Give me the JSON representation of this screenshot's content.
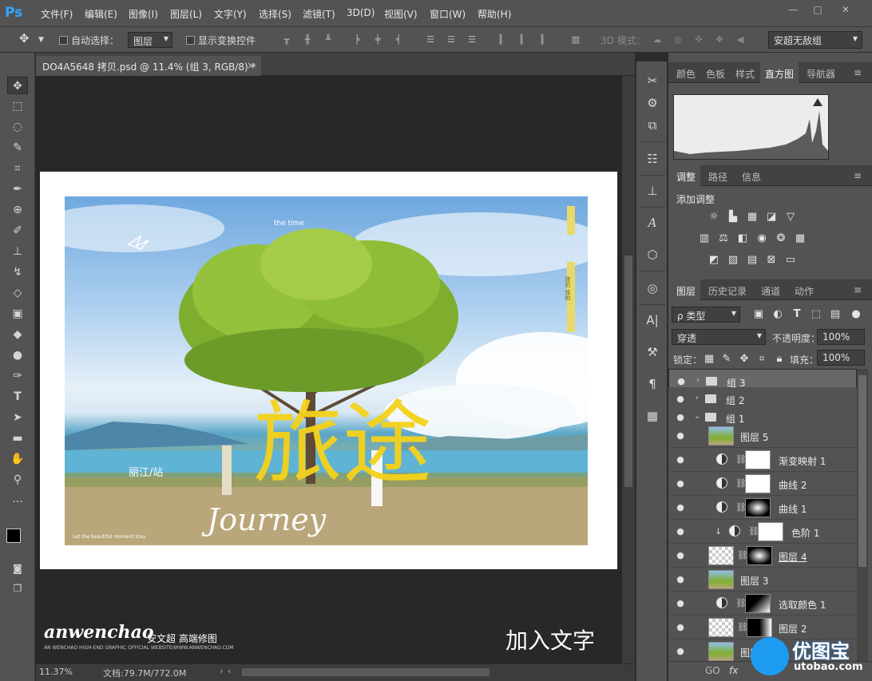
{
  "app": {
    "logo": "Ps"
  },
  "menu": [
    "文件(F)",
    "编辑(E)",
    "图像(I)",
    "图层(L)",
    "文字(Y)",
    "选择(S)",
    "滤镜(T)",
    "3D(D)",
    "视图(V)",
    "窗口(W)",
    "帮助(H)"
  ],
  "window": {
    "minimize": "—",
    "maximize": "□",
    "close": "✕"
  },
  "options": {
    "auto_select_label": "自动选择：",
    "auto_select_value": "图层",
    "show_transform_label": "显示变换控件",
    "mode_3d_label": "3D 模式：",
    "workspace": "安超无敌组"
  },
  "document": {
    "tab_title": "DO4A5648 拷贝.psd @ 11.4% (组 3, RGB/8) *",
    "tab_close": "×"
  },
  "artwork": {
    "title_cn": "旅途",
    "subtitle_cn": "丽江/站",
    "script_en": "Journey",
    "side_text": "旅拍 旅拍",
    "small_line": "the time",
    "footer_line": "Let the beautiful moment stay",
    "brand": "anwenchao",
    "brand_cn": "安文超 高端修图",
    "brand_small": "AN WENCHAO HIGH-END GRAPHIC OFFICIAL WEBSITE/WWW.ANWENCHAO.COM",
    "caption": "加入文字"
  },
  "status": {
    "zoom": "11.37%",
    "doc_info": "文档:79.7M/772.0M"
  },
  "panels": {
    "top_tabs": [
      "颜色",
      "色板",
      "样式",
      "直方图",
      "导航器"
    ],
    "top_active": "直方图",
    "adjust_tabs": [
      "调整",
      "路径",
      "信息"
    ],
    "adjust_active": "调整",
    "adjust_heading": "添加调整",
    "layer_tabs": [
      "图层",
      "历史记录",
      "通道",
      "动作"
    ],
    "layer_active": "图层",
    "filter_kind": "ρ 类型",
    "blend_mode": "穿透",
    "opacity_label": "不透明度：",
    "opacity_value": "100%",
    "lock_label": "锁定：",
    "fill_label": "填充：",
    "fill_value": "100%"
  },
  "layers": [
    {
      "name": "组 3",
      "type": "group",
      "indent": 0,
      "expanded": false,
      "selected": true
    },
    {
      "name": "组 2",
      "type": "group",
      "indent": 0,
      "expanded": false,
      "selected": false
    },
    {
      "name": "组 1",
      "type": "group",
      "indent": 0,
      "expanded": true,
      "selected": false
    },
    {
      "name": "图层 5",
      "type": "image",
      "indent": 1,
      "selected": false
    },
    {
      "name": "渐变映射 1",
      "type": "adjust",
      "indent": 1,
      "selected": false
    },
    {
      "name": "曲线 2",
      "type": "adjust",
      "indent": 1,
      "selected": false
    },
    {
      "name": "曲线 1",
      "type": "adjust",
      "indent": 1,
      "selected": false
    },
    {
      "name": "色阶 1",
      "type": "adjust",
      "indent": 2,
      "selected": false
    },
    {
      "name": "图层 4",
      "type": "image",
      "indent": 1,
      "selected": false
    },
    {
      "name": "图层 3",
      "type": "image",
      "indent": 1,
      "selected": false
    },
    {
      "name": "选取颜色 1",
      "type": "adjust",
      "indent": 1,
      "selected": false
    },
    {
      "name": "图层 2",
      "type": "image",
      "indent": 1,
      "selected": false
    },
    {
      "name": "图层 1",
      "type": "image",
      "indent": 1,
      "selected": false
    }
  ],
  "layer_footer": [
    "GO",
    "fx"
  ],
  "watermark": {
    "text": "优图宝",
    "url": "utobao.com"
  },
  "colors": {
    "accent": "#31a8ff",
    "title_yellow": "#f5d21a"
  }
}
